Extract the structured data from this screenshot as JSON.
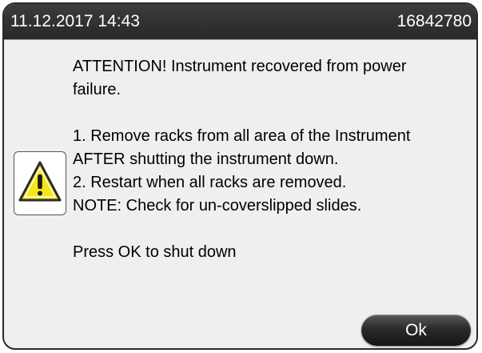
{
  "title_bar": {
    "datetime": "11.12.2017 14:43",
    "id": "16842780"
  },
  "message": {
    "lines": [
      "ATTENTION! Instrument recovered from power",
      "failure.",
      "",
      "1. Remove racks from all area of the Instrument",
      "AFTER shutting the instrument down.",
      "2. Restart when all racks are removed.",
      "NOTE: Check for un-coverslipped slides.",
      "",
      "Press OK to shut down"
    ]
  },
  "icon": "warning-triangle-icon",
  "colors": {
    "title_bar": "#2f2f2f",
    "dialog_background": "#efefef",
    "warning_yellow": "#f7e51c"
  },
  "buttons": {
    "ok_label": "Ok"
  }
}
